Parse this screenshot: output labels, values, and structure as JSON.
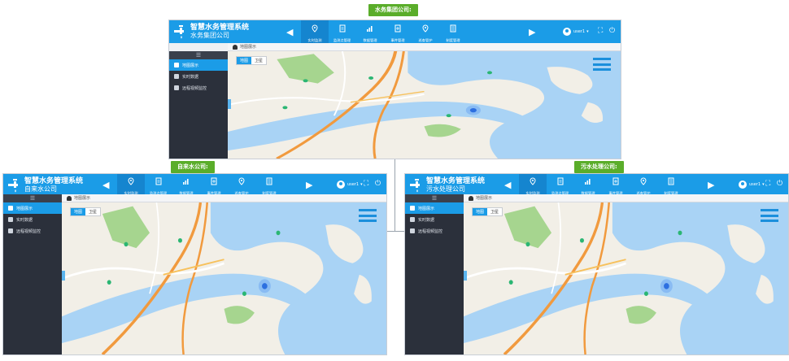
{
  "labels": {
    "group": "水务集团公司:",
    "water": "自来水公司:",
    "sewage": "污水处理公司:"
  },
  "app": {
    "title": "智慧水务管理系统",
    "user": "user1",
    "nav": [
      {
        "label": "实时监测",
        "icon": "location-pin-icon"
      },
      {
        "label": "监测点管理",
        "icon": "document-icon"
      },
      {
        "label": "数据管理",
        "icon": "bar-chart-icon"
      },
      {
        "label": "事件管理",
        "icon": "document-plus-icon"
      },
      {
        "label": "巡查管护",
        "icon": "location-pin-icon"
      },
      {
        "label": "制度管理",
        "icon": "document-list-icon"
      }
    ],
    "sidebar": [
      "地图展示",
      "实时数据",
      "远程视频监控"
    ],
    "sidebar_toggle": "☰",
    "breadcrumb": "地图展示",
    "map_toggle": [
      "地图",
      "卫星"
    ],
    "nav_prev": "◀",
    "nav_next": "▶",
    "fullscreen": "⛶",
    "power": "⏻"
  },
  "instances": {
    "group": {
      "subtitle": "水务集团公司"
    },
    "water": {
      "subtitle": "自来水公司"
    },
    "sewage": {
      "subtitle": "污水处理公司"
    }
  },
  "colors": {
    "header": "#1b9ce7",
    "active_tab": "#1585cf",
    "sidebar": "#2b303b",
    "tag": "#5aad2a",
    "water": "#a9d3f5",
    "land": "#f2efe7",
    "park": "#a6d58f",
    "highway": "#f19a3e"
  }
}
